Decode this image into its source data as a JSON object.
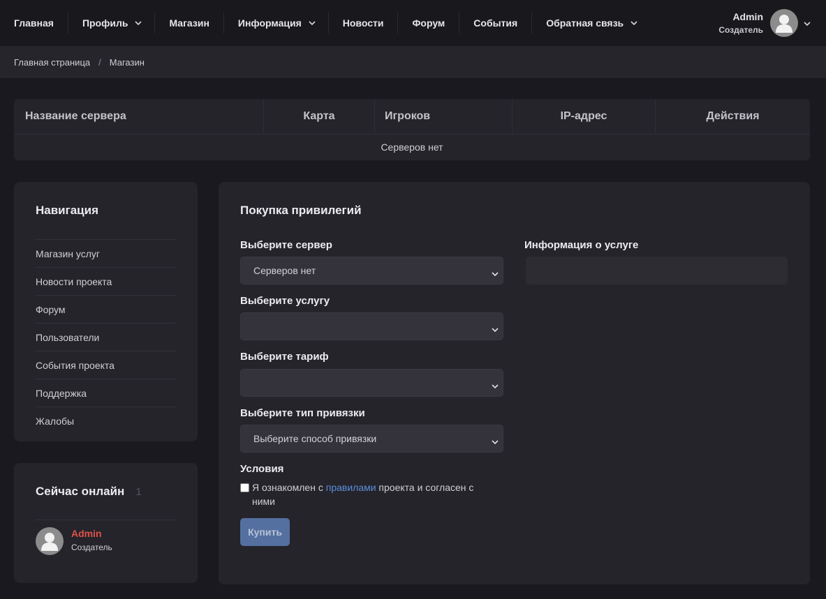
{
  "topnav": {
    "items": [
      {
        "label": "Главная",
        "dropdown": false
      },
      {
        "label": "Профиль",
        "dropdown": true
      },
      {
        "label": "Магазин",
        "dropdown": false
      },
      {
        "label": "Информация",
        "dropdown": true
      },
      {
        "label": "Новости",
        "dropdown": false
      },
      {
        "label": "Форум",
        "dropdown": false
      },
      {
        "label": "События",
        "dropdown": false
      },
      {
        "label": "Обратная связь",
        "dropdown": true
      }
    ],
    "user": {
      "name": "Admin",
      "role": "Создатель"
    }
  },
  "breadcrumb": {
    "home": "Главная страница",
    "separator": "/",
    "current": "Магазин"
  },
  "server_table": {
    "columns": [
      "Название сервера",
      "Карта",
      "Игроков",
      "IP-адрес",
      "Действия"
    ],
    "empty_text": "Серверов нет"
  },
  "navigation": {
    "title": "Навигация",
    "items": [
      "Магазин услуг",
      "Новости проекта",
      "Форум",
      "Пользователи",
      "События проекта",
      "Поддержка",
      "Жалобы"
    ]
  },
  "online": {
    "title": "Сейчас онлайн",
    "count": "1",
    "user": {
      "name": "Admin",
      "role": "Создатель"
    }
  },
  "purchase": {
    "title": "Покупка привилегий",
    "server_label": "Выберите сервер",
    "server_value": "Серверов нет",
    "service_label": "Выберите услугу",
    "service_value": "",
    "tariff_label": "Выберите тариф",
    "tariff_value": "",
    "binding_label": "Выберите тип привязки",
    "binding_value": "Выберите способ привязки",
    "info_label": "Информация о услуге",
    "terms_label": "Условия",
    "terms_before": "Я ознакомлен с ",
    "terms_link": "правилами",
    "terms_after": " проекта и согласен с ними",
    "buy_label": "Купить"
  },
  "colors": {
    "background": "#1a191f",
    "card": "#25242b",
    "accent_button": "#5470a0",
    "link": "#5b8fd9",
    "online_name": "#e0524a"
  }
}
